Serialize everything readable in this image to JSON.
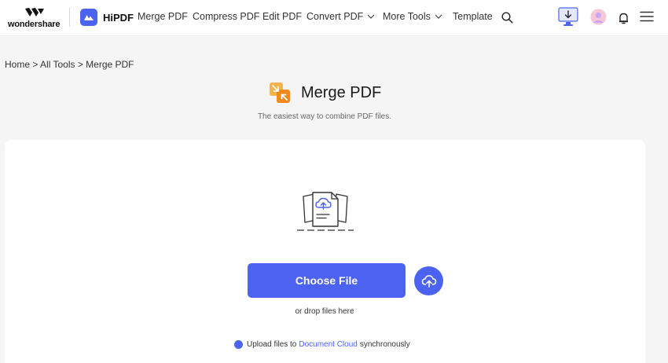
{
  "header": {
    "brand_wordmark": "wondershare",
    "product_name": "HiPDF",
    "nav": [
      {
        "label": "Merge PDF"
      },
      {
        "label": "Compress PDF"
      },
      {
        "label": "Edit PDF"
      },
      {
        "label": "Convert PDF"
      },
      {
        "label": "More Tools"
      },
      {
        "label": "Template"
      }
    ],
    "icons": [
      "search-icon",
      "download-desktop-icon",
      "avatar",
      "bell-icon",
      "menu-icon"
    ]
  },
  "breadcrumb": "Home > All Tools > Merge PDF",
  "page": {
    "title": "Merge PDF",
    "subtitle": "The easiest way to combine PDF files."
  },
  "upload": {
    "choose_label": "Choose File",
    "drop_text": "or drop files here",
    "sync_prefix": "Upload files to",
    "sync_link": "Document Cloud",
    "sync_suffix": "synchronously"
  },
  "colors": {
    "accent": "#4c63f2",
    "tool_icon": "#f59a23",
    "background": "#f5f5f5"
  }
}
